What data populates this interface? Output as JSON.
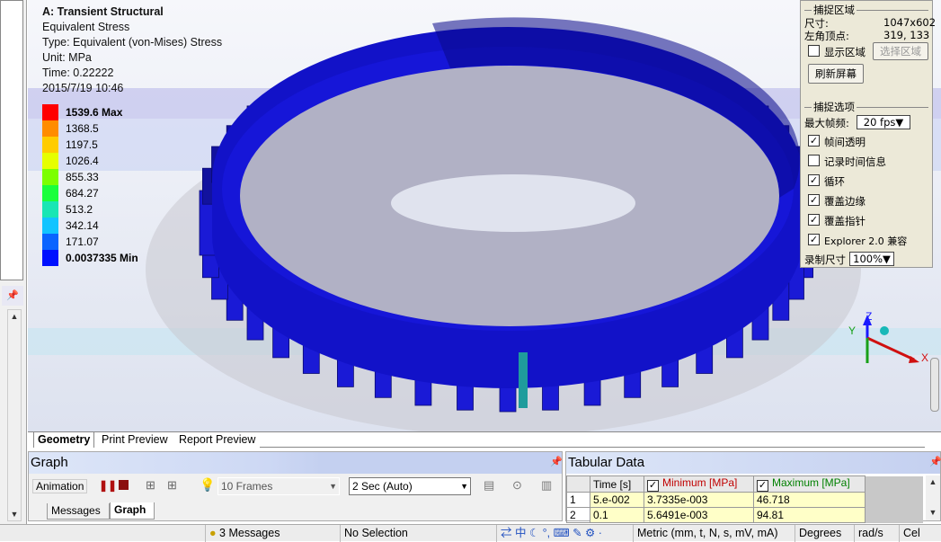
{
  "viewport": {
    "title": "A: Transient Structural",
    "result": "Equivalent Stress",
    "type": "Type: Equivalent (von-Mises) Stress",
    "unit": "Unit: MPa",
    "time": "Time: 0.22222",
    "date": "2015/7/19 10:46",
    "legend": [
      {
        "label": "1539.6 Max",
        "color": "#ff0000",
        "bold": true
      },
      {
        "label": "1368.5",
        "color": "#ff8c00"
      },
      {
        "label": "1197.5",
        "color": "#ffcc00"
      },
      {
        "label": "1026.4",
        "color": "#e6ff00"
      },
      {
        "label": "855.33",
        "color": "#7cff00"
      },
      {
        "label": "684.27",
        "color": "#1aff3c"
      },
      {
        "label": "513.2",
        "color": "#19e6b4"
      },
      {
        "label": "342.14",
        "color": "#12c4ff"
      },
      {
        "label": "171.07",
        "color": "#0a64ff"
      },
      {
        "label": "0.0037335 Min",
        "color": "#0010ff",
        "bold": true
      }
    ],
    "triad": {
      "x": "X",
      "y": "Y",
      "z": "Z"
    }
  },
  "capture": {
    "area_group": "捕捉区域",
    "size_label": "尺寸:",
    "size_value": "1047x602",
    "origin_label": "左角顶点:",
    "origin_value": "319, 133",
    "show_area": "显示区域",
    "select_area": "选择区域",
    "refresh": "刷新屏幕",
    "options_group": "捕捉选项",
    "max_fps_label": "最大帧频:",
    "max_fps_value": "20 fps",
    "options": [
      {
        "label": "帧间透明",
        "checked": true
      },
      {
        "label": "记录时间信息",
        "checked": false
      },
      {
        "label": "循环",
        "checked": true
      },
      {
        "label": "覆盖边缘",
        "checked": true
      },
      {
        "label": "覆盖指针",
        "checked": true
      },
      {
        "label": "Explorer 2.0 兼容",
        "checked": true
      }
    ],
    "record_size_label": "录制尺寸",
    "record_size_value": "100%"
  },
  "view_tabs": [
    "Geometry",
    "Print Preview",
    "Report Preview"
  ],
  "graph": {
    "title": "Graph",
    "animation_label": "Animation",
    "frames": "10 Frames",
    "duration": "2 Sec (Auto)",
    "tabs": [
      "Messages",
      "Graph"
    ]
  },
  "tabular": {
    "title": "Tabular Data",
    "headers": [
      "Time [s]",
      "Minimum [MPa]",
      "Maximum [MPa]"
    ],
    "min_color": "#c00000",
    "max_color": "#008000",
    "rows": [
      {
        "n": "1",
        "time": "5.e-002",
        "min": "3.7335e-003",
        "max": "46.718"
      },
      {
        "n": "2",
        "time": "0.1",
        "min": "5.6491e-003",
        "max": "94.81"
      }
    ]
  },
  "status": {
    "messages": "3 Messages",
    "selection": "No Selection",
    "ime": "中",
    "units": "Metric (mm, t, N, s, mV, mA)",
    "angle": "Degrees",
    "rate": "rad/s",
    "temp": "Cel"
  }
}
